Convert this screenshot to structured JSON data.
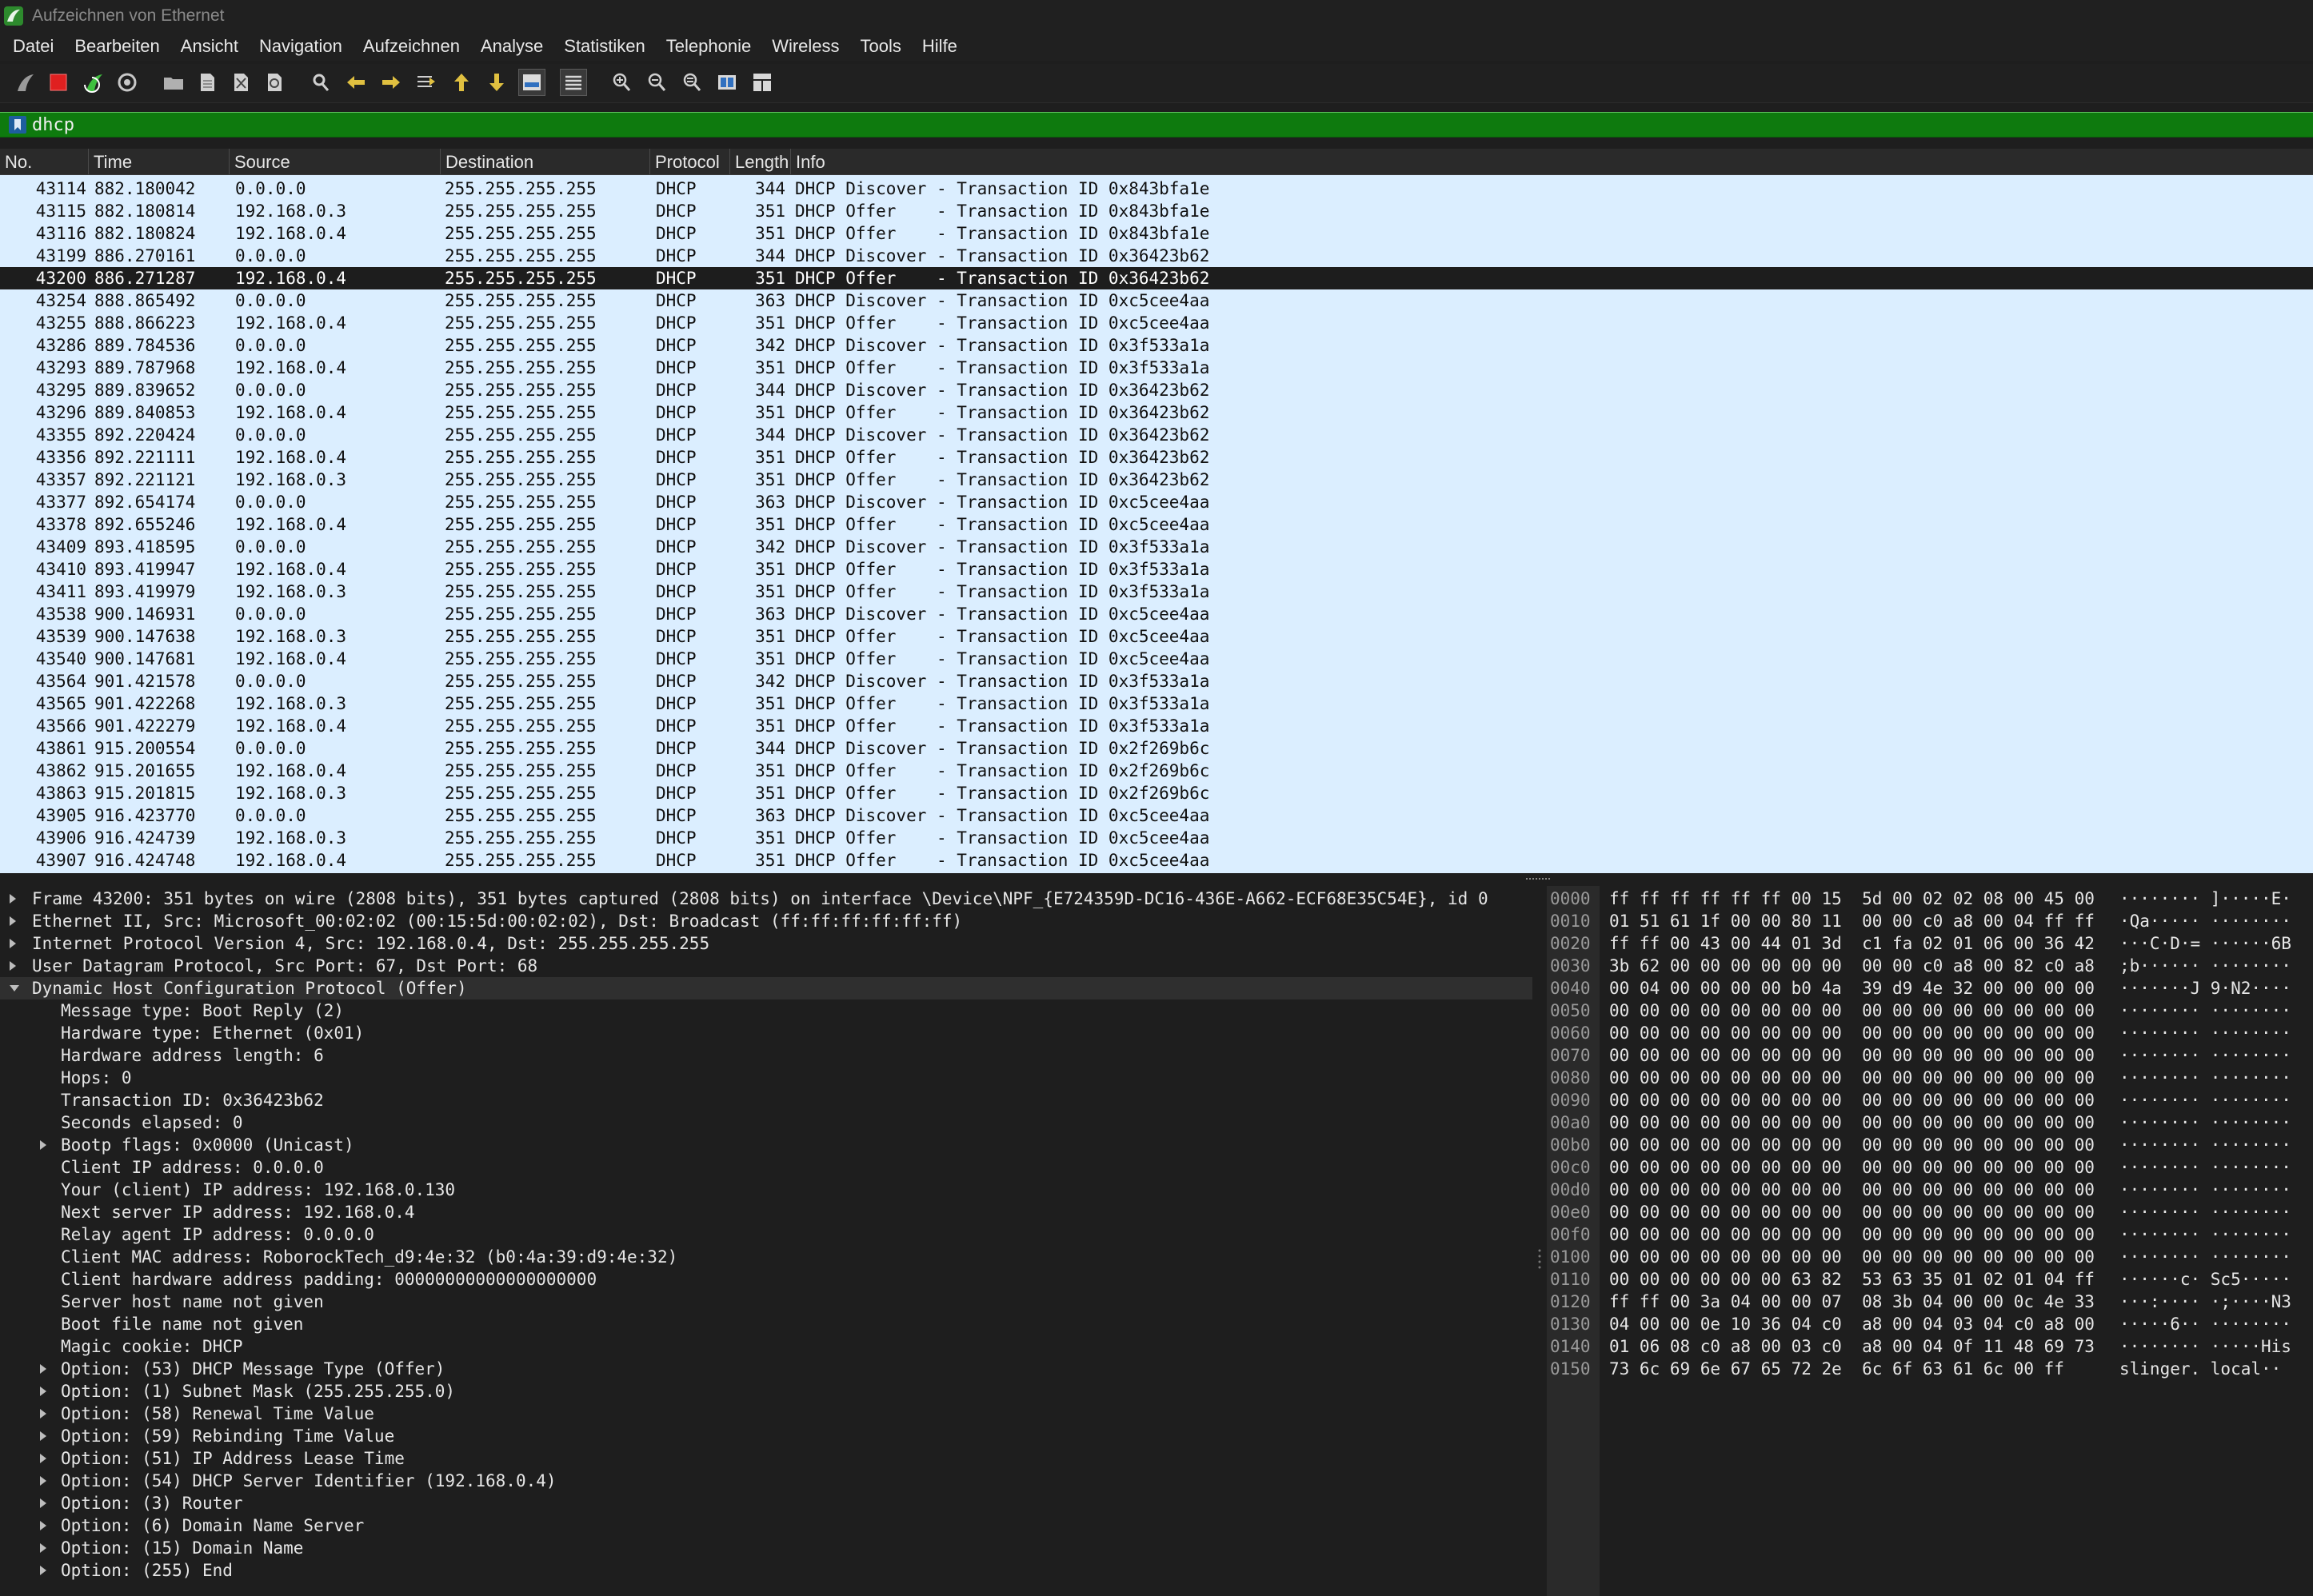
{
  "window": {
    "title": "Aufzeichnen von Ethernet"
  },
  "menu": [
    "Datei",
    "Bearbeiten",
    "Ansicht",
    "Navigation",
    "Aufzeichnen",
    "Analyse",
    "Statistiken",
    "Telephonie",
    "Wireless",
    "Tools",
    "Hilfe"
  ],
  "toolbar": [
    {
      "name": "start-capture-icon",
      "icon": "shark-fin"
    },
    {
      "name": "stop-capture-icon",
      "icon": "red-square"
    },
    {
      "name": "restart-capture-icon",
      "icon": "green-fin-arrow"
    },
    {
      "name": "capture-options-icon",
      "icon": "gear"
    },
    {
      "name": "open-file-icon",
      "icon": "folder"
    },
    {
      "name": "save-file-icon",
      "icon": "document"
    },
    {
      "name": "close-file-icon",
      "icon": "document-x"
    },
    {
      "name": "reload-file-icon",
      "icon": "document-reload"
    },
    {
      "name": "find-packet-icon",
      "icon": "magnifier"
    },
    {
      "name": "go-back-icon",
      "icon": "arrow-left"
    },
    {
      "name": "go-forward-icon",
      "icon": "arrow-right"
    },
    {
      "name": "go-to-packet-icon",
      "icon": "arrow-jump"
    },
    {
      "name": "go-first-packet-icon",
      "icon": "arrow-up"
    },
    {
      "name": "go-last-packet-icon",
      "icon": "arrow-down"
    },
    {
      "name": "autoscroll-icon",
      "icon": "autoscroll"
    },
    {
      "name": "colorize-icon",
      "icon": "lines"
    },
    {
      "name": "zoom-in-icon",
      "icon": "zoom-plus"
    },
    {
      "name": "zoom-out-icon",
      "icon": "zoom-minus"
    },
    {
      "name": "zoom-reset-icon",
      "icon": "zoom-equal"
    },
    {
      "name": "resize-columns-icon",
      "icon": "columns"
    },
    {
      "name": "layout-icon",
      "icon": "grid"
    }
  ],
  "filter": {
    "value": "dhcp"
  },
  "packet_list": {
    "columns": [
      "No.",
      "Time",
      "Source",
      "Destination",
      "Protocol",
      "Length",
      "Info"
    ],
    "selected_index": 4,
    "rows": [
      [
        "43114",
        "882.180042",
        "0.0.0.0",
        "255.255.255.255",
        "DHCP",
        "344",
        "DHCP Discover - Transaction ID 0x843bfa1e"
      ],
      [
        "43115",
        "882.180814",
        "192.168.0.3",
        "255.255.255.255",
        "DHCP",
        "351",
        "DHCP Offer    - Transaction ID 0x843bfa1e"
      ],
      [
        "43116",
        "882.180824",
        "192.168.0.4",
        "255.255.255.255",
        "DHCP",
        "351",
        "DHCP Offer    - Transaction ID 0x843bfa1e"
      ],
      [
        "43199",
        "886.270161",
        "0.0.0.0",
        "255.255.255.255",
        "DHCP",
        "344",
        "DHCP Discover - Transaction ID 0x36423b62"
      ],
      [
        "43200",
        "886.271287",
        "192.168.0.4",
        "255.255.255.255",
        "DHCP",
        "351",
        "DHCP Offer    - Transaction ID 0x36423b62"
      ],
      [
        "43254",
        "888.865492",
        "0.0.0.0",
        "255.255.255.255",
        "DHCP",
        "363",
        "DHCP Discover - Transaction ID 0xc5cee4aa"
      ],
      [
        "43255",
        "888.866223",
        "192.168.0.4",
        "255.255.255.255",
        "DHCP",
        "351",
        "DHCP Offer    - Transaction ID 0xc5cee4aa"
      ],
      [
        "43286",
        "889.784536",
        "0.0.0.0",
        "255.255.255.255",
        "DHCP",
        "342",
        "DHCP Discover - Transaction ID 0x3f533a1a"
      ],
      [
        "43293",
        "889.787968",
        "192.168.0.4",
        "255.255.255.255",
        "DHCP",
        "351",
        "DHCP Offer    - Transaction ID 0x3f533a1a"
      ],
      [
        "43295",
        "889.839652",
        "0.0.0.0",
        "255.255.255.255",
        "DHCP",
        "344",
        "DHCP Discover - Transaction ID 0x36423b62"
      ],
      [
        "43296",
        "889.840853",
        "192.168.0.4",
        "255.255.255.255",
        "DHCP",
        "351",
        "DHCP Offer    - Transaction ID 0x36423b62"
      ],
      [
        "43355",
        "892.220424",
        "0.0.0.0",
        "255.255.255.255",
        "DHCP",
        "344",
        "DHCP Discover - Transaction ID 0x36423b62"
      ],
      [
        "43356",
        "892.221111",
        "192.168.0.4",
        "255.255.255.255",
        "DHCP",
        "351",
        "DHCP Offer    - Transaction ID 0x36423b62"
      ],
      [
        "43357",
        "892.221121",
        "192.168.0.3",
        "255.255.255.255",
        "DHCP",
        "351",
        "DHCP Offer    - Transaction ID 0x36423b62"
      ],
      [
        "43377",
        "892.654174",
        "0.0.0.0",
        "255.255.255.255",
        "DHCP",
        "363",
        "DHCP Discover - Transaction ID 0xc5cee4aa"
      ],
      [
        "43378",
        "892.655246",
        "192.168.0.4",
        "255.255.255.255",
        "DHCP",
        "351",
        "DHCP Offer    - Transaction ID 0xc5cee4aa"
      ],
      [
        "43409",
        "893.418595",
        "0.0.0.0",
        "255.255.255.255",
        "DHCP",
        "342",
        "DHCP Discover - Transaction ID 0x3f533a1a"
      ],
      [
        "43410",
        "893.419947",
        "192.168.0.4",
        "255.255.255.255",
        "DHCP",
        "351",
        "DHCP Offer    - Transaction ID 0x3f533a1a"
      ],
      [
        "43411",
        "893.419979",
        "192.168.0.3",
        "255.255.255.255",
        "DHCP",
        "351",
        "DHCP Offer    - Transaction ID 0x3f533a1a"
      ],
      [
        "43538",
        "900.146931",
        "0.0.0.0",
        "255.255.255.255",
        "DHCP",
        "363",
        "DHCP Discover - Transaction ID 0xc5cee4aa"
      ],
      [
        "43539",
        "900.147638",
        "192.168.0.3",
        "255.255.255.255",
        "DHCP",
        "351",
        "DHCP Offer    - Transaction ID 0xc5cee4aa"
      ],
      [
        "43540",
        "900.147681",
        "192.168.0.4",
        "255.255.255.255",
        "DHCP",
        "351",
        "DHCP Offer    - Transaction ID 0xc5cee4aa"
      ],
      [
        "43564",
        "901.421578",
        "0.0.0.0",
        "255.255.255.255",
        "DHCP",
        "342",
        "DHCP Discover - Transaction ID 0x3f533a1a"
      ],
      [
        "43565",
        "901.422268",
        "192.168.0.3",
        "255.255.255.255",
        "DHCP",
        "351",
        "DHCP Offer    - Transaction ID 0x3f533a1a"
      ],
      [
        "43566",
        "901.422279",
        "192.168.0.4",
        "255.255.255.255",
        "DHCP",
        "351",
        "DHCP Offer    - Transaction ID 0x3f533a1a"
      ],
      [
        "43861",
        "915.200554",
        "0.0.0.0",
        "255.255.255.255",
        "DHCP",
        "344",
        "DHCP Discover - Transaction ID 0x2f269b6c"
      ],
      [
        "43862",
        "915.201655",
        "192.168.0.4",
        "255.255.255.255",
        "DHCP",
        "351",
        "DHCP Offer    - Transaction ID 0x2f269b6c"
      ],
      [
        "43863",
        "915.201815",
        "192.168.0.3",
        "255.255.255.255",
        "DHCP",
        "351",
        "DHCP Offer    - Transaction ID 0x2f269b6c"
      ],
      [
        "43905",
        "916.423770",
        "0.0.0.0",
        "255.255.255.255",
        "DHCP",
        "363",
        "DHCP Discover - Transaction ID 0xc5cee4aa"
      ],
      [
        "43906",
        "916.424739",
        "192.168.0.3",
        "255.255.255.255",
        "DHCP",
        "351",
        "DHCP Offer    - Transaction ID 0xc5cee4aa"
      ],
      [
        "43907",
        "916.424748",
        "192.168.0.4",
        "255.255.255.255",
        "DHCP",
        "351",
        "DHCP Offer    - Transaction ID 0xc5cee4aa"
      ]
    ]
  },
  "details": [
    {
      "indent": 0,
      "expander": "collapsed",
      "text": "Frame 43200: 351 bytes on wire (2808 bits), 351 bytes captured (2808 bits) on interface \\Device\\NPF_{E724359D-DC16-436E-A662-ECF68E35C54E}, id 0"
    },
    {
      "indent": 0,
      "expander": "collapsed",
      "text": "Ethernet II, Src: Microsoft_00:02:02 (00:15:5d:00:02:02), Dst: Broadcast (ff:ff:ff:ff:ff:ff)"
    },
    {
      "indent": 0,
      "expander": "collapsed",
      "text": "Internet Protocol Version 4, Src: 192.168.0.4, Dst: 255.255.255.255"
    },
    {
      "indent": 0,
      "expander": "collapsed",
      "text": "User Datagram Protocol, Src Port: 67, Dst Port: 68"
    },
    {
      "indent": 0,
      "expander": "expanded",
      "text": "Dynamic Host Configuration Protocol (Offer)",
      "selected": true
    },
    {
      "indent": 1,
      "expander": "none",
      "text": "Message type: Boot Reply (2)"
    },
    {
      "indent": 1,
      "expander": "none",
      "text": "Hardware type: Ethernet (0x01)"
    },
    {
      "indent": 1,
      "expander": "none",
      "text": "Hardware address length: 6"
    },
    {
      "indent": 1,
      "expander": "none",
      "text": "Hops: 0"
    },
    {
      "indent": 1,
      "expander": "none",
      "text": "Transaction ID: 0x36423b62"
    },
    {
      "indent": 1,
      "expander": "none",
      "text": "Seconds elapsed: 0"
    },
    {
      "indent": 1,
      "expander": "collapsed",
      "text": "Bootp flags: 0x0000 (Unicast)"
    },
    {
      "indent": 1,
      "expander": "none",
      "text": "Client IP address: 0.0.0.0"
    },
    {
      "indent": 1,
      "expander": "none",
      "text": "Your (client) IP address: 192.168.0.130"
    },
    {
      "indent": 1,
      "expander": "none",
      "text": "Next server IP address: 192.168.0.4"
    },
    {
      "indent": 1,
      "expander": "none",
      "text": "Relay agent IP address: 0.0.0.0"
    },
    {
      "indent": 1,
      "expander": "none",
      "text": "Client MAC address: RoborockTech_d9:4e:32 (b0:4a:39:d9:4e:32)"
    },
    {
      "indent": 1,
      "expander": "none",
      "text": "Client hardware address padding: 00000000000000000000"
    },
    {
      "indent": 1,
      "expander": "none",
      "text": "Server host name not given"
    },
    {
      "indent": 1,
      "expander": "none",
      "text": "Boot file name not given"
    },
    {
      "indent": 1,
      "expander": "none",
      "text": "Magic cookie: DHCP"
    },
    {
      "indent": 1,
      "expander": "collapsed",
      "text": "Option: (53) DHCP Message Type (Offer)"
    },
    {
      "indent": 1,
      "expander": "collapsed",
      "text": "Option: (1) Subnet Mask (255.255.255.0)"
    },
    {
      "indent": 1,
      "expander": "collapsed",
      "text": "Option: (58) Renewal Time Value"
    },
    {
      "indent": 1,
      "expander": "collapsed",
      "text": "Option: (59) Rebinding Time Value"
    },
    {
      "indent": 1,
      "expander": "collapsed",
      "text": "Option: (51) IP Address Lease Time"
    },
    {
      "indent": 1,
      "expander": "collapsed",
      "text": "Option: (54) DHCP Server Identifier (192.168.0.4)"
    },
    {
      "indent": 1,
      "expander": "collapsed",
      "text": "Option: (3) Router"
    },
    {
      "indent": 1,
      "expander": "collapsed",
      "text": "Option: (6) Domain Name Server"
    },
    {
      "indent": 1,
      "expander": "collapsed",
      "text": "Option: (15) Domain Name"
    },
    {
      "indent": 1,
      "expander": "collapsed",
      "text": "Option: (255) End"
    }
  ],
  "hex": [
    {
      "offset": "0000",
      "bytes": "ff ff ff ff ff ff 00 15  5d 00 02 02 08 00 45 00",
      "ascii": "········ ]·····E·"
    },
    {
      "offset": "0010",
      "bytes": "01 51 61 1f 00 00 80 11  00 00 c0 a8 00 04 ff ff",
      "ascii": "·Qa····· ········"
    },
    {
      "offset": "0020",
      "bytes": "ff ff 00 43 00 44 01 3d  c1 fa 02 01 06 00 36 42",
      "ascii": "···C·D·= ······6B"
    },
    {
      "offset": "0030",
      "bytes": "3b 62 00 00 00 00 00 00  00 00 c0 a8 00 82 c0 a8",
      "ascii": ";b······ ········"
    },
    {
      "offset": "0040",
      "bytes": "00 04 00 00 00 00 b0 4a  39 d9 4e 32 00 00 00 00",
      "ascii": "·······J 9·N2····"
    },
    {
      "offset": "0050",
      "bytes": "00 00 00 00 00 00 00 00  00 00 00 00 00 00 00 00",
      "ascii": "········ ········"
    },
    {
      "offset": "0060",
      "bytes": "00 00 00 00 00 00 00 00  00 00 00 00 00 00 00 00",
      "ascii": "········ ········"
    },
    {
      "offset": "0070",
      "bytes": "00 00 00 00 00 00 00 00  00 00 00 00 00 00 00 00",
      "ascii": "········ ········"
    },
    {
      "offset": "0080",
      "bytes": "00 00 00 00 00 00 00 00  00 00 00 00 00 00 00 00",
      "ascii": "········ ········"
    },
    {
      "offset": "0090",
      "bytes": "00 00 00 00 00 00 00 00  00 00 00 00 00 00 00 00",
      "ascii": "········ ········"
    },
    {
      "offset": "00a0",
      "bytes": "00 00 00 00 00 00 00 00  00 00 00 00 00 00 00 00",
      "ascii": "········ ········"
    },
    {
      "offset": "00b0",
      "bytes": "00 00 00 00 00 00 00 00  00 00 00 00 00 00 00 00",
      "ascii": "········ ········"
    },
    {
      "offset": "00c0",
      "bytes": "00 00 00 00 00 00 00 00  00 00 00 00 00 00 00 00",
      "ascii": "········ ········"
    },
    {
      "offset": "00d0",
      "bytes": "00 00 00 00 00 00 00 00  00 00 00 00 00 00 00 00",
      "ascii": "········ ········"
    },
    {
      "offset": "00e0",
      "bytes": "00 00 00 00 00 00 00 00  00 00 00 00 00 00 00 00",
      "ascii": "········ ········"
    },
    {
      "offset": "00f0",
      "bytes": "00 00 00 00 00 00 00 00  00 00 00 00 00 00 00 00",
      "ascii": "········ ········"
    },
    {
      "offset": "0100",
      "bytes": "00 00 00 00 00 00 00 00  00 00 00 00 00 00 00 00",
      "ascii": "········ ········"
    },
    {
      "offset": "0110",
      "bytes": "00 00 00 00 00 00 63 82  53 63 35 01 02 01 04 ff",
      "ascii": "······c· Sc5·····"
    },
    {
      "offset": "0120",
      "bytes": "ff ff 00 3a 04 00 00 07  08 3b 04 00 00 0c 4e 33",
      "ascii": "···:···· ·;····N3"
    },
    {
      "offset": "0130",
      "bytes": "04 00 00 0e 10 36 04 c0  a8 00 04 03 04 c0 a8 00",
      "ascii": "·····6·· ········"
    },
    {
      "offset": "0140",
      "bytes": "01 06 08 c0 a8 00 03 c0  a8 00 04 0f 11 48 69 73",
      "ascii": "········ ·····His"
    },
    {
      "offset": "0150",
      "bytes": "73 6c 69 6e 67 65 72 2e  6c 6f 63 61 6c 00 ff",
      "ascii": "slinger. local··"
    }
  ],
  "colors": {
    "accent": "#0e7a0e",
    "row_bg": "#dbeeff",
    "selected_row": "#1d1d1d"
  }
}
